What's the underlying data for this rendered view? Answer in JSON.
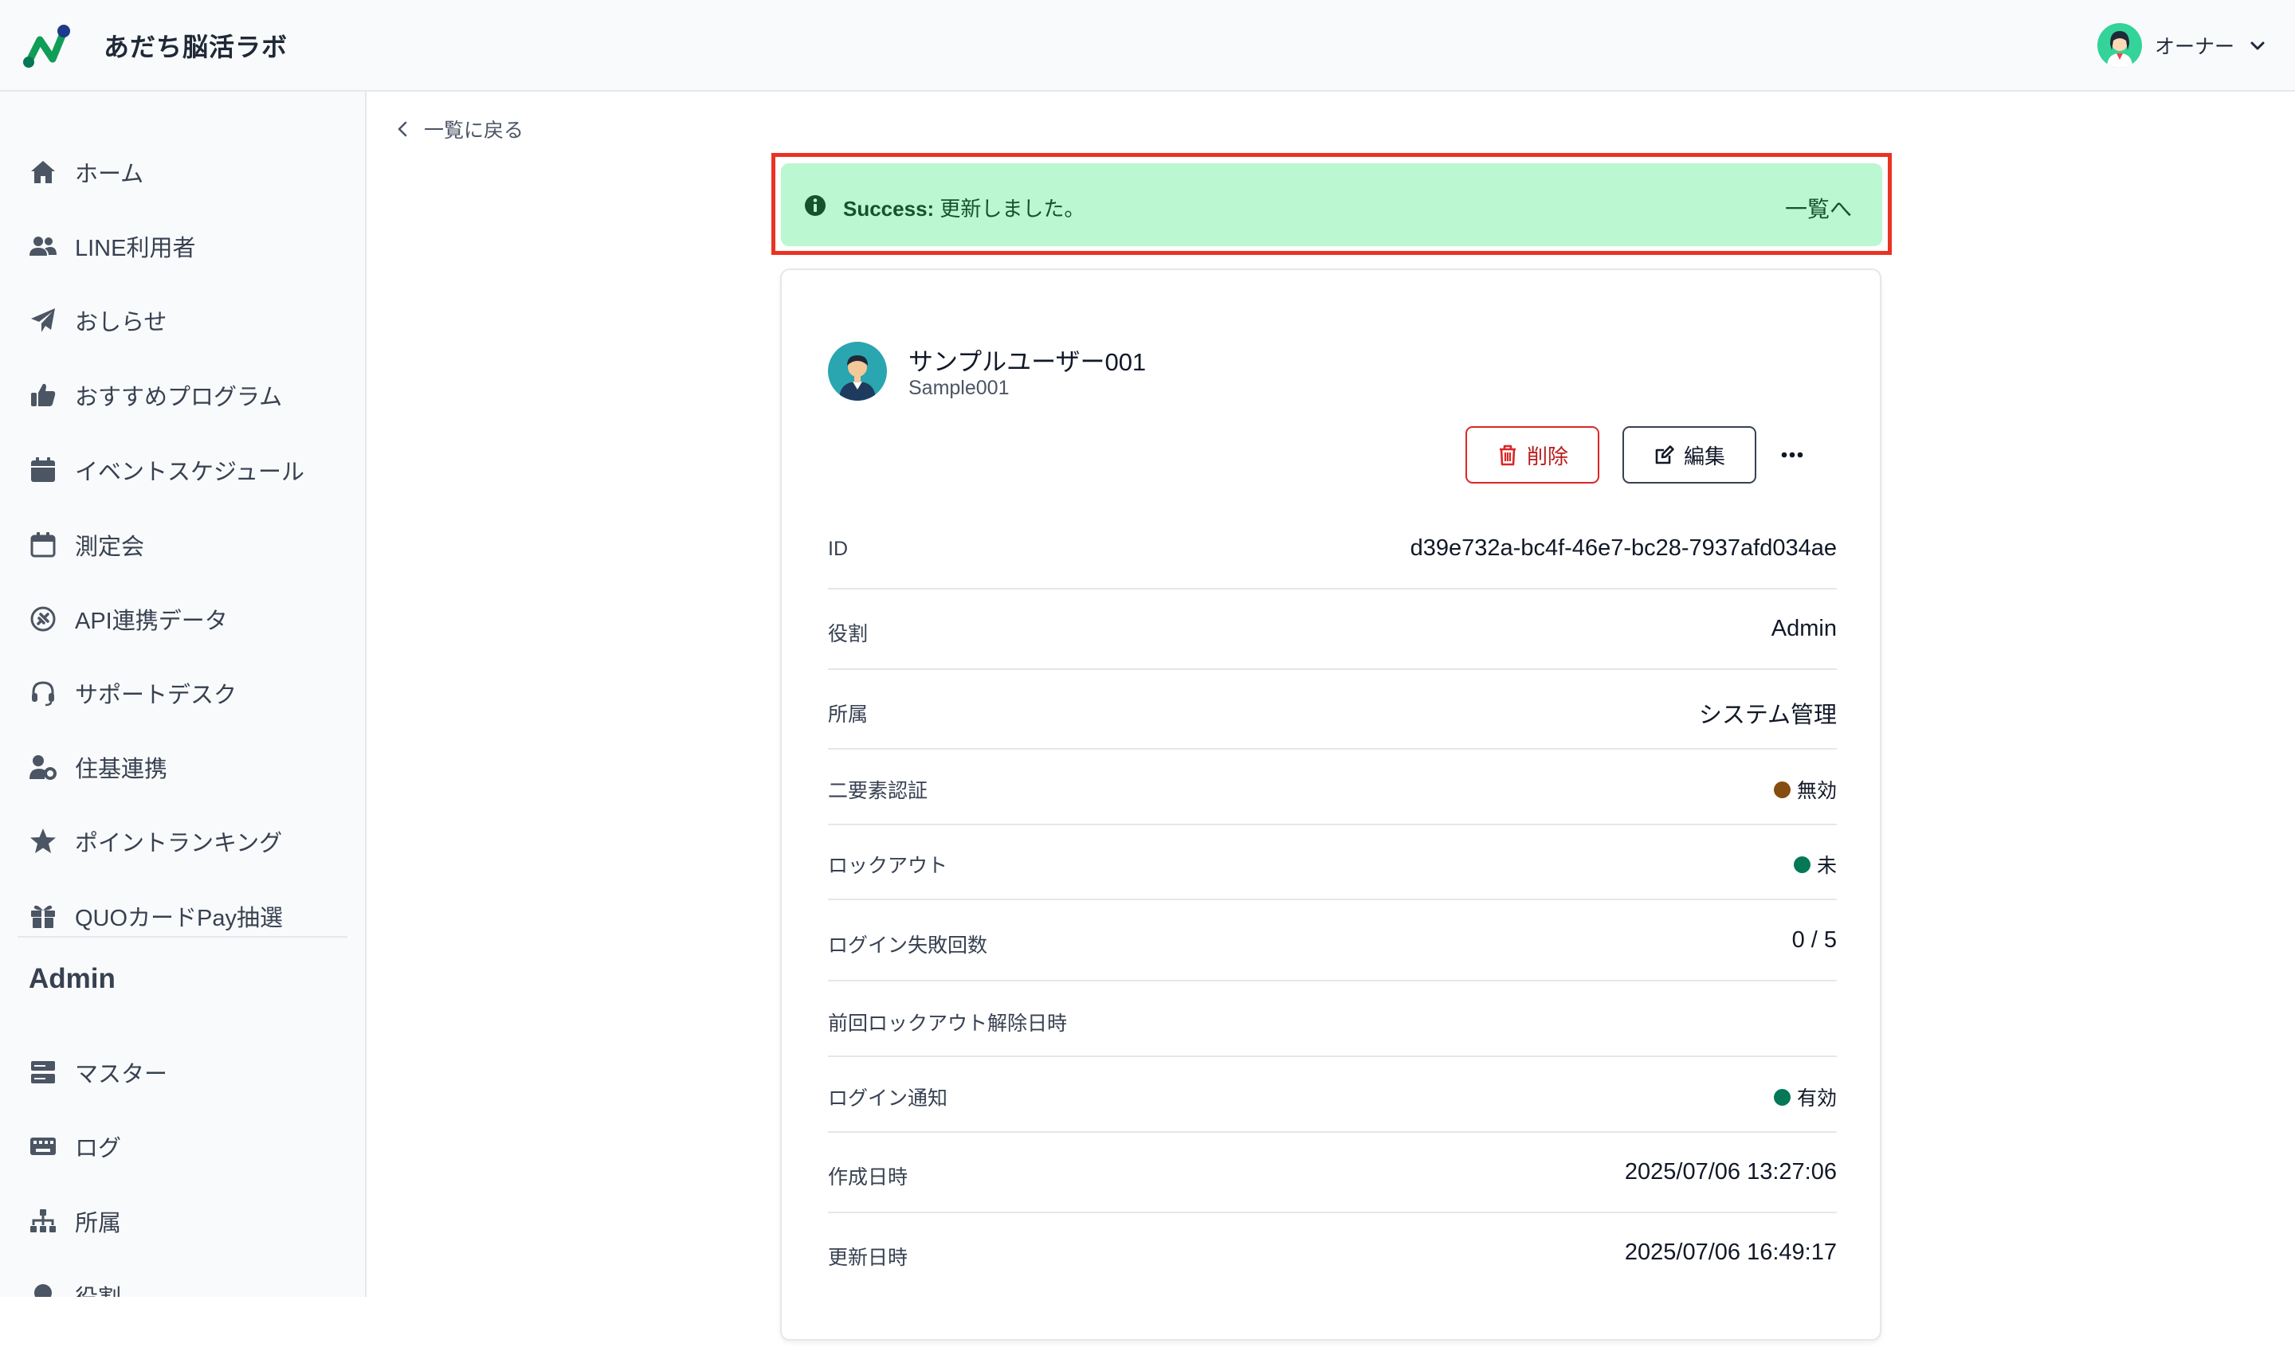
{
  "app": {
    "title": "あだち脳活ラボ"
  },
  "user_menu": {
    "name": "オーナー"
  },
  "sidebar": {
    "items": [
      {
        "label": "ホーム",
        "icon": "home-icon"
      },
      {
        "label": "LINE利用者",
        "icon": "users-icon"
      },
      {
        "label": "おしらせ",
        "icon": "paper-plane-icon"
      },
      {
        "label": "おすすめプログラム",
        "icon": "thumbs-up-icon"
      },
      {
        "label": "イベントスケジュール",
        "icon": "calendar-filled-icon"
      },
      {
        "label": "測定会",
        "icon": "calendar-icon"
      },
      {
        "label": "API連携データ",
        "icon": "plug-icon"
      },
      {
        "label": "サポートデスク",
        "icon": "headset-icon"
      },
      {
        "label": "住基連携",
        "icon": "user-gear-icon"
      },
      {
        "label": "ポイントランキング",
        "icon": "star-icon"
      },
      {
        "label": "QUOカードPay抽選",
        "icon": "gift-icon"
      }
    ],
    "admin_heading": "Admin",
    "admin_items": [
      {
        "label": "マスター",
        "icon": "server-icon"
      },
      {
        "label": "ログ",
        "icon": "keyboard-icon"
      },
      {
        "label": "所属",
        "icon": "sitemap-icon"
      },
      {
        "label": "役割",
        "icon": "award-icon"
      }
    ]
  },
  "back_link": {
    "label": "一覧に戻る"
  },
  "alert": {
    "prefix": "Success:",
    "message": " 更新しました。",
    "link": "一覧へ",
    "bg_color": "#bbf7d0",
    "highlight_color": "#ea3323"
  },
  "profile": {
    "name": "サンプルユーザー001",
    "username": "Sample001"
  },
  "actions": {
    "delete_label": "削除",
    "edit_label": "編集",
    "more_label": "…"
  },
  "details": {
    "id": {
      "label": "ID",
      "value": "d39e732a-bc4f-46e7-bc28-7937afd034ae"
    },
    "role": {
      "label": "役割",
      "value": "Admin"
    },
    "affiliation": {
      "label": "所属",
      "value": "システム管理"
    },
    "two_factor": {
      "label": "二要素認証",
      "value": "無効",
      "color": "#854d0e"
    },
    "lockout": {
      "label": "ロックアウト",
      "value": "未",
      "color": "#047857"
    },
    "login_failures": {
      "label": "ログイン失敗回数",
      "value": "0 / 5"
    },
    "last_unlock": {
      "label": "前回ロックアウト解除日時",
      "value": ""
    },
    "login_notify": {
      "label": "ログイン通知",
      "value": "有効",
      "color": "#047857"
    },
    "created_at": {
      "label": "作成日時",
      "value": "2025/07/06 13:27:06"
    },
    "updated_at": {
      "label": "更新日時",
      "value": "2025/07/06 16:49:17"
    }
  }
}
